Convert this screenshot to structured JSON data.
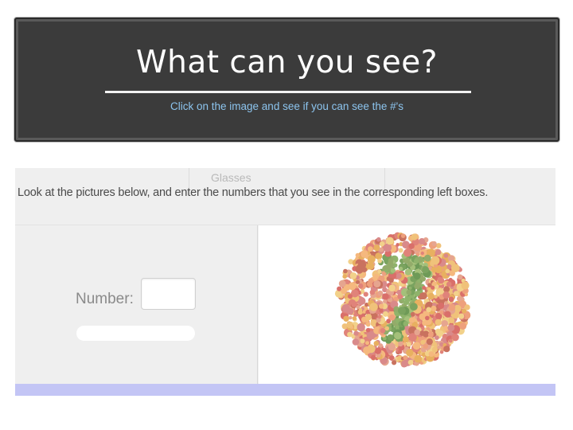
{
  "header": {
    "title": "What can you see?",
    "subtitle": "Click on the image and see if you can see the #'s"
  },
  "panel": {
    "ghost_tab": "Glasses",
    "instruction": "Look at the pictures below, and enter the numbers that you see in the corresponding left boxes.",
    "number_label": "Number:",
    "number_value": "",
    "plate_icon": "ishihara-color-plate",
    "colors": {
      "header_bg": "#3b3b3b",
      "subtitle": "#8cc4ee",
      "footer_bar": "#c3c5f5"
    }
  }
}
